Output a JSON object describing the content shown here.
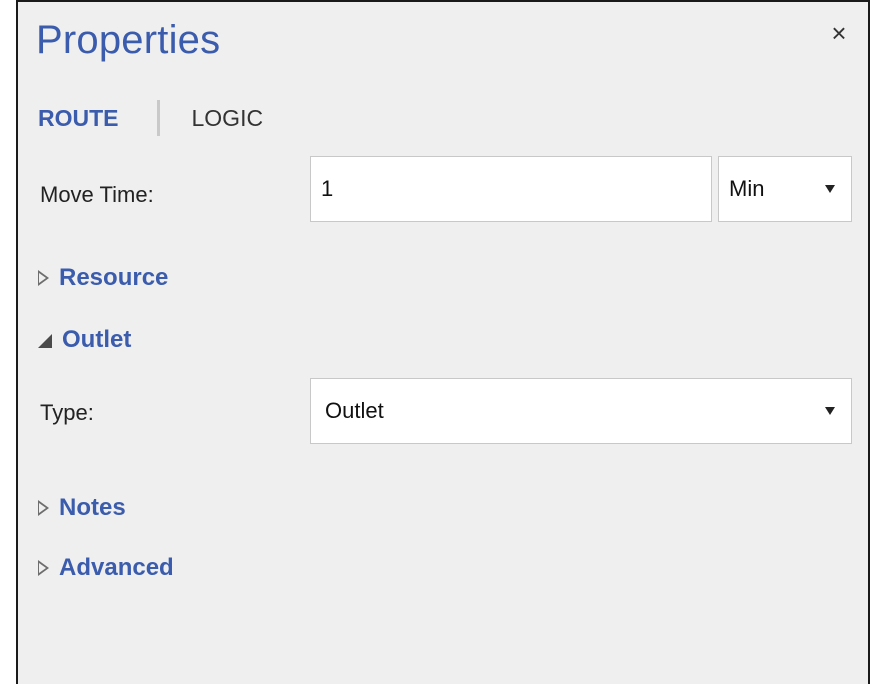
{
  "panel": {
    "title": "Properties",
    "close_icon": "×"
  },
  "tabs": [
    {
      "label": "ROUTE",
      "active": true
    },
    {
      "label": "LOGIC",
      "active": false
    }
  ],
  "move_time": {
    "label": "Move Time:",
    "value": "1",
    "unit": "Min"
  },
  "sections": {
    "resource": "Resource",
    "outlet": "Outlet",
    "notes": "Notes",
    "advanced": "Advanced"
  },
  "outlet": {
    "type_label": "Type:",
    "type_value": "Outlet"
  },
  "colors": {
    "accent": "#3b5cad",
    "panel_bg": "#efefef"
  }
}
